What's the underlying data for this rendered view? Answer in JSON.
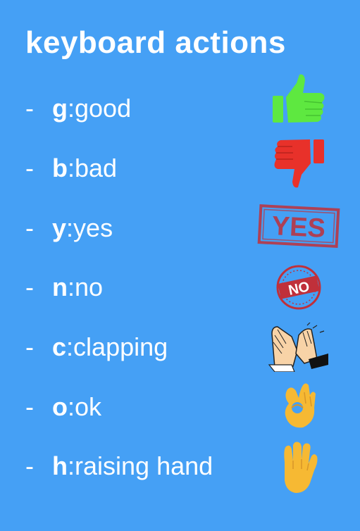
{
  "title": "keyboard actions",
  "actions": [
    {
      "dash": "-",
      "key": "g",
      "sep": ":",
      "label": " good",
      "icon": "thumbs-up-icon"
    },
    {
      "dash": "-",
      "key": "b",
      "sep": ":",
      "label": " bad",
      "icon": "thumbs-down-icon"
    },
    {
      "dash": "-",
      "key": "y",
      "sep": ":",
      "label": " yes",
      "icon": "yes-stamp-icon",
      "stamp_text": "YES"
    },
    {
      "dash": "-",
      "key": "n",
      "sep": ":",
      "label": " no",
      "icon": "no-stamp-icon",
      "stamp_text": "NO"
    },
    {
      "dash": "-",
      "key": "c",
      "sep": ":",
      "label": " clapping",
      "icon": "clapping-hands-icon"
    },
    {
      "dash": "-",
      "key": "o",
      "sep": ":",
      "label": " ok",
      "icon": "ok-hand-icon"
    },
    {
      "dash": "-",
      "key": "h",
      "sep": ":",
      "label": " raising hand",
      "icon": "raised-hand-icon"
    }
  ],
  "colors": {
    "background": "#45a0f5",
    "text": "#ffffff",
    "thumbs_up": "#5ee840",
    "thumbs_down": "#e8312a",
    "stamp_red": "#c0303a",
    "emoji_yellow": "#f6b933"
  }
}
